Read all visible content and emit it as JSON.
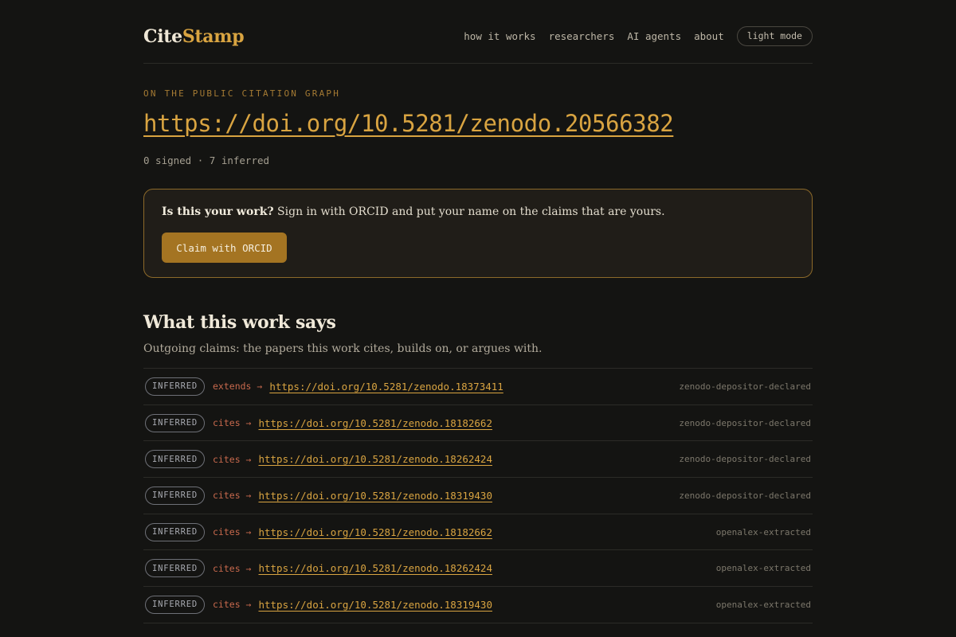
{
  "header": {
    "logo_cite": "Cite",
    "logo_stamp": "Stamp",
    "nav": [
      "how it works",
      "researchers",
      "AI agents",
      "about"
    ],
    "mode_button": "light mode"
  },
  "work": {
    "eyebrow": "ON THE PUBLIC CITATION GRAPH",
    "doi": "https://doi.org/10.5281/zenodo.20566382",
    "counts": "0 signed · 7 inferred"
  },
  "claim_box": {
    "question": "Is this your work?",
    "text": " Sign in with ORCID and put your name on the claims that are yours.",
    "button": "Claim with ORCID"
  },
  "section": {
    "title": "What this work says",
    "subtitle": "Outgoing claims: the papers this work cites, builds on, or argues with."
  },
  "claims": [
    {
      "badge": "INFERRED",
      "relation": "extends →",
      "target": "https://doi.org/10.5281/zenodo.18373411",
      "source": "zenodo-depositor-declared"
    },
    {
      "badge": "INFERRED",
      "relation": "cites →",
      "target": "https://doi.org/10.5281/zenodo.18182662",
      "source": "zenodo-depositor-declared"
    },
    {
      "badge": "INFERRED",
      "relation": "cites →",
      "target": "https://doi.org/10.5281/zenodo.18262424",
      "source": "zenodo-depositor-declared"
    },
    {
      "badge": "INFERRED",
      "relation": "cites →",
      "target": "https://doi.org/10.5281/zenodo.18319430",
      "source": "zenodo-depositor-declared"
    },
    {
      "badge": "INFERRED",
      "relation": "cites →",
      "target": "https://doi.org/10.5281/zenodo.18182662",
      "source": "openalex-extracted"
    },
    {
      "badge": "INFERRED",
      "relation": "cites →",
      "target": "https://doi.org/10.5281/zenodo.18262424",
      "source": "openalex-extracted"
    },
    {
      "badge": "INFERRED",
      "relation": "cites →",
      "target": "https://doi.org/10.5281/zenodo.18319430",
      "source": "openalex-extracted"
    }
  ],
  "colors": {
    "background": "#141412",
    "accent": "#d9a441",
    "relation": "#c8694d",
    "button": "#a47422"
  }
}
